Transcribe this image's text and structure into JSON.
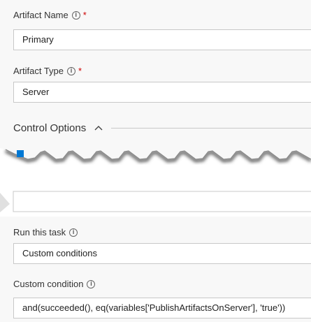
{
  "artifact_name": {
    "label": "Artifact Name",
    "info_glyph": "i",
    "required_marker": "*",
    "value": "Primary"
  },
  "artifact_type": {
    "label": "Artifact Type",
    "info_glyph": "i",
    "required_marker": "*",
    "value": "Server"
  },
  "control_options": {
    "title": "Control Options",
    "expanded": true,
    "icon": "chevron-up-icon"
  },
  "run_this_task": {
    "label": "Run this task",
    "info_glyph": "i",
    "value": "Custom conditions"
  },
  "custom_condition": {
    "label": "Custom condition",
    "info_glyph": "i",
    "value": "and(succeeded(), eq(variables['PublishArtifactsOnServer'], 'true'))"
  },
  "colors": {
    "background": "#f8f8f8",
    "field_border": "#c8c8c8",
    "required": "#cc0000",
    "accent": "#0078d4"
  }
}
